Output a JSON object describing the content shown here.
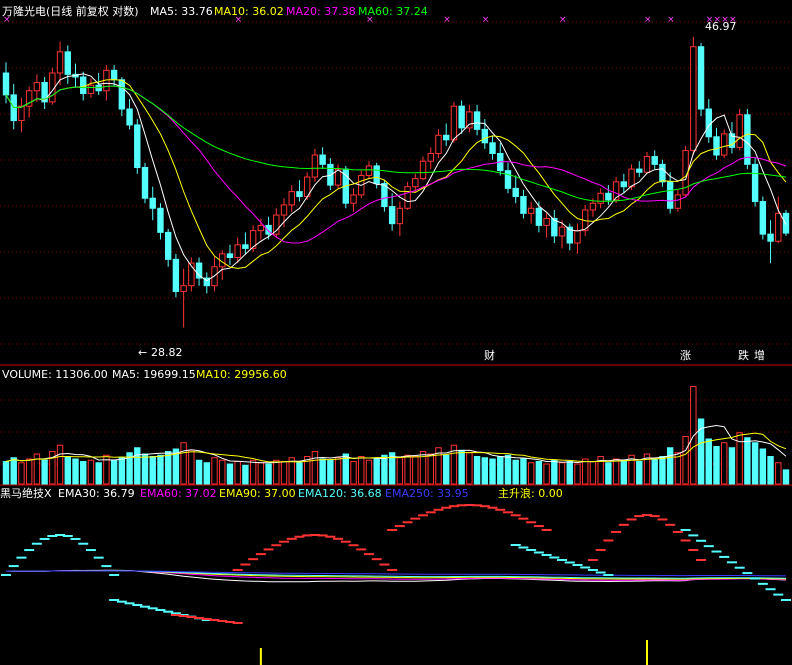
{
  "colors": {
    "up": "#ff3333",
    "down": "#54ffff",
    "ma5": "#ffffff",
    "ma10": "#ffff00",
    "ma20": "#ff00ff",
    "ma60": "#00ff00",
    "grid": "#8a0000",
    "ema30": "#ffffff",
    "ema60": "#ff00ff",
    "ema90": "#ffff00",
    "ema120": "#54ffff",
    "ema250": "#3a3aff",
    "wave": "#ffff00"
  },
  "header": {
    "title": "万隆光电(日线 前复权 对数)",
    "ma5": "MA5: 33.76",
    "ma10": "MA10: 36.02",
    "ma20": "MA20: 37.38",
    "ma60": "MA60: 37.24"
  },
  "volume_header": {
    "volume": "VOLUME: 11306.00",
    "ma5": "MA5: 19699.15",
    "ma10": "MA10: 29956.60"
  },
  "indicator_header": {
    "name": "黑马绝技X",
    "ema30": "EMA30: 36.79",
    "ema60": "EMA60: 37.02",
    "ema90": "EMA90: 37.00",
    "ema120": "EMA120: 36.68",
    "ema250": "EMA250: 33.95",
    "wave": "主升浪: 0.00"
  },
  "annotations": {
    "high": "46.97",
    "low": "28.82",
    "low_prefix": "←",
    "badges": [
      "财",
      "涨",
      "跌",
      "增"
    ]
  },
  "chart_data": [
    {
      "type": "candlestick",
      "title": "万隆光电(日线 前复权 对数)",
      "ohlc": [
        [
          44.2,
          45.0,
          42.0,
          42.6
        ],
        [
          42.6,
          43.4,
          40.2,
          40.8
        ],
        [
          40.8,
          42.4,
          40.0,
          41.8
        ],
        [
          41.8,
          43.2,
          41.0,
          42.9
        ],
        [
          42.9,
          44.1,
          42.1,
          43.5
        ],
        [
          43.5,
          43.9,
          41.6,
          42.1
        ],
        [
          42.1,
          44.6,
          41.9,
          44.2
        ],
        [
          44.2,
          46.6,
          43.3,
          45.8
        ],
        [
          45.8,
          46.3,
          43.4,
          44.1
        ],
        [
          44.1,
          44.9,
          43.1,
          43.9
        ],
        [
          43.9,
          44.3,
          42.2,
          42.7
        ],
        [
          42.7,
          43.8,
          42.4,
          43.3
        ],
        [
          43.3,
          44.2,
          42.6,
          42.9
        ],
        [
          42.9,
          44.8,
          42.2,
          44.4
        ],
        [
          44.4,
          44.8,
          43.2,
          43.7
        ],
        [
          43.7,
          43.9,
          41.1,
          41.6
        ],
        [
          41.6,
          42.3,
          40.2,
          40.5
        ],
        [
          40.5,
          40.9,
          37.3,
          37.7
        ],
        [
          37.7,
          38.0,
          35.5,
          35.8
        ],
        [
          35.8,
          36.5,
          34.5,
          35.2
        ],
        [
          35.2,
          35.5,
          33.4,
          33.8
        ],
        [
          33.8,
          34.0,
          31.9,
          32.3
        ],
        [
          32.3,
          32.6,
          30.3,
          30.6
        ],
        [
          30.6,
          31.8,
          28.8,
          30.9
        ],
        [
          30.9,
          32.4,
          30.6,
          32.1
        ],
        [
          32.1,
          32.4,
          30.9,
          31.3
        ],
        [
          31.3,
          31.6,
          30.5,
          30.9
        ],
        [
          30.9,
          32.5,
          30.6,
          31.9
        ],
        [
          31.9,
          32.8,
          31.2,
          32.6
        ],
        [
          32.6,
          33.1,
          32.0,
          32.4
        ],
        [
          32.4,
          33.5,
          32.1,
          33.1
        ],
        [
          33.1,
          33.8,
          32.6,
          32.9
        ],
        [
          32.9,
          34.2,
          32.7,
          33.9
        ],
        [
          33.9,
          34.6,
          33.4,
          34.2
        ],
        [
          34.2,
          34.7,
          33.4,
          33.7
        ],
        [
          33.7,
          35.2,
          33.5,
          34.8
        ],
        [
          34.8,
          35.8,
          34.1,
          35.4
        ],
        [
          35.4,
          36.6,
          35.0,
          36.2
        ],
        [
          36.2,
          36.9,
          35.6,
          35.9
        ],
        [
          35.9,
          37.4,
          35.7,
          37.1
        ],
        [
          37.1,
          38.9,
          36.8,
          38.5
        ],
        [
          38.5,
          39.0,
          37.6,
          37.9
        ],
        [
          37.9,
          38.3,
          36.3,
          36.6
        ],
        [
          36.6,
          37.9,
          36.4,
          37.6
        ],
        [
          37.6,
          37.8,
          35.2,
          35.5
        ],
        [
          35.5,
          36.4,
          35.0,
          36.0
        ],
        [
          36.0,
          37.5,
          35.8,
          37.2
        ],
        [
          37.2,
          38.1,
          37.0,
          37.8
        ],
        [
          37.8,
          38.0,
          36.4,
          36.7
        ],
        [
          36.7,
          36.9,
          35.0,
          35.3
        ],
        [
          35.3,
          36.1,
          33.9,
          34.3
        ],
        [
          34.3,
          35.6,
          33.6,
          35.2
        ],
        [
          35.2,
          36.8,
          35.1,
          36.5
        ],
        [
          36.5,
          37.3,
          36.2,
          37.0
        ],
        [
          37.0,
          38.4,
          36.9,
          38.1
        ],
        [
          38.1,
          39.0,
          37.6,
          38.6
        ],
        [
          38.6,
          40.2,
          38.3,
          39.8
        ],
        [
          39.8,
          40.6,
          39.1,
          39.5
        ],
        [
          39.5,
          42.1,
          39.3,
          41.8
        ],
        [
          41.8,
          42.2,
          39.9,
          40.3
        ],
        [
          40.3,
          41.9,
          40.0,
          41.4
        ],
        [
          41.4,
          41.9,
          39.8,
          40.2
        ],
        [
          40.2,
          40.9,
          38.9,
          39.3
        ],
        [
          39.3,
          39.8,
          38.2,
          38.6
        ],
        [
          38.6,
          39.3,
          37.2,
          37.5
        ],
        [
          37.5,
          38.0,
          36.1,
          36.4
        ],
        [
          36.4,
          37.2,
          35.5,
          35.9
        ],
        [
          35.9,
          36.3,
          34.6,
          34.9
        ],
        [
          34.9,
          35.6,
          34.3,
          35.2
        ],
        [
          35.2,
          35.6,
          33.8,
          34.2
        ],
        [
          34.2,
          34.9,
          33.5,
          34.6
        ],
        [
          34.6,
          35.1,
          33.2,
          33.6
        ],
        [
          33.6,
          34.5,
          32.9,
          34.1
        ],
        [
          34.1,
          34.3,
          32.8,
          33.2
        ],
        [
          33.2,
          34.3,
          32.6,
          33.9
        ],
        [
          33.9,
          35.4,
          33.6,
          35.1
        ],
        [
          35.1,
          35.8,
          34.7,
          35.5
        ],
        [
          35.5,
          36.4,
          35.2,
          36.1
        ],
        [
          36.1,
          36.6,
          35.4,
          35.7
        ],
        [
          35.7,
          37.1,
          35.5,
          36.8
        ],
        [
          36.8,
          37.3,
          36.1,
          36.5
        ],
        [
          36.5,
          37.9,
          36.3,
          37.6
        ],
        [
          37.6,
          38.1,
          37.1,
          37.4
        ],
        [
          37.4,
          38.7,
          37.3,
          38.4
        ],
        [
          38.4,
          38.8,
          37.6,
          37.9
        ],
        [
          37.9,
          38.2,
          36.5,
          36.8
        ],
        [
          36.8,
          37.4,
          34.9,
          35.2
        ],
        [
          35.2,
          36.3,
          35.0,
          36.0
        ],
        [
          36.0,
          39.1,
          35.9,
          38.8
        ],
        [
          38.8,
          46.97,
          38.5,
          46.2
        ],
        [
          46.2,
          46.5,
          41.1,
          41.6
        ],
        [
          41.6,
          42.3,
          39.3,
          39.7
        ],
        [
          39.7,
          40.3,
          38.2,
          38.5
        ],
        [
          38.5,
          40.2,
          38.3,
          39.9
        ],
        [
          39.9,
          40.7,
          38.6,
          39.0
        ],
        [
          39.0,
          41.6,
          38.8,
          41.2
        ],
        [
          41.2,
          41.6,
          37.6,
          37.9
        ],
        [
          37.9,
          38.3,
          35.3,
          35.6
        ],
        [
          35.6,
          35.9,
          33.4,
          33.7
        ],
        [
          33.7,
          34.5,
          32.1,
          33.3
        ],
        [
          33.3,
          35.9,
          33.2,
          34.9
        ],
        [
          34.9,
          35.1,
          33.6,
          33.76
        ]
      ],
      "ma": {
        "MA5": 33.76,
        "MA10": 36.02,
        "MA20": 37.38,
        "MA60": 37.24
      },
      "high_label": 46.97,
      "low_label": 28.82,
      "log_scale": true,
      "grid": true
    },
    {
      "type": "bar",
      "title": "VOLUME",
      "values": [
        18000,
        21000,
        17000,
        20000,
        24000,
        19000,
        26000,
        31000,
        22000,
        20000,
        18000,
        19000,
        17000,
        23000,
        19000,
        21000,
        25000,
        29000,
        24000,
        22000,
        23000,
        26000,
        28000,
        33000,
        27000,
        19000,
        17000,
        21000,
        19000,
        16000,
        18000,
        15000,
        19000,
        17000,
        16000,
        19000,
        18000,
        21000,
        17000,
        22000,
        26000,
        20000,
        19000,
        21000,
        24000,
        18000,
        22000,
        19000,
        20000,
        23000,
        25000,
        21000,
        23000,
        22000,
        26000,
        24000,
        29000,
        23000,
        31000,
        27000,
        25000,
        22000,
        21000,
        20000,
        22000,
        23000,
        19000,
        20000,
        17000,
        18000,
        16000,
        19000,
        17000,
        18000,
        16000,
        20000,
        18000,
        22000,
        17000,
        20000,
        19000,
        23000,
        18000,
        24000,
        20000,
        22000,
        29000,
        25000,
        38000,
        78000,
        52000,
        36000,
        30000,
        33000,
        29000,
        41000,
        37000,
        33000,
        28000,
        22000,
        17000,
        11306
      ],
      "ma": {
        "MA5": 19699.15,
        "MA10": 29956.6
      }
    },
    {
      "type": "line",
      "title": "黑马绝技X",
      "series_values": {
        "EMA30": 36.79,
        "EMA60": 37.02,
        "EMA90": 37.0,
        "EMA120": 36.68,
        "EMA250": 33.95,
        "主升浪": 0.0
      }
    }
  ]
}
